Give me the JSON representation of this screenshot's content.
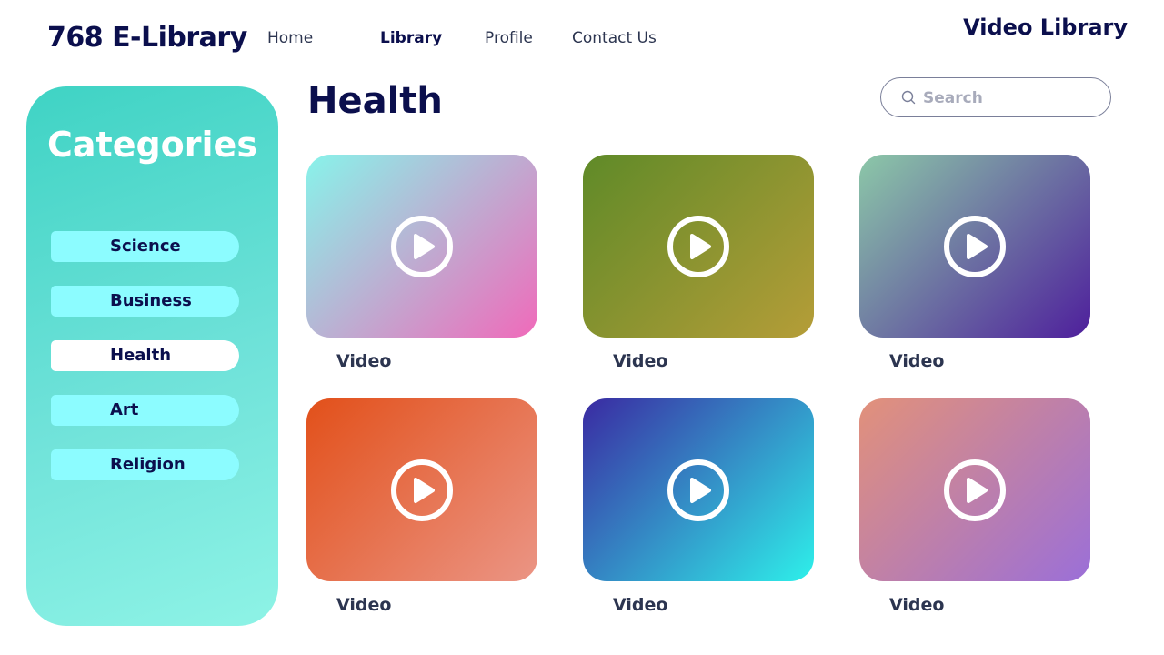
{
  "header": {
    "brand": "768 E-Library",
    "nav": [
      "Home",
      "Library",
      "Profile",
      "Contact Us"
    ],
    "active_nav": "Library",
    "page_label": "Video Library"
  },
  "sidebar": {
    "title": "Categories",
    "items": [
      "Science",
      "Business",
      "Health",
      "Art",
      "Religion"
    ],
    "active": "Health"
  },
  "main": {
    "heading": "Health",
    "search": {
      "placeholder": "Search",
      "value": ""
    },
    "videos": [
      {
        "label": "Video",
        "gradient": [
          "#88f3ea",
          "#f06aba"
        ]
      },
      {
        "label": "Video",
        "gradient": [
          "#5f8a28",
          "#b59d38"
        ]
      },
      {
        "label": "Video",
        "gradient": [
          "#8cc8a8",
          "#4e1f9c"
        ]
      },
      {
        "label": "Video",
        "gradient": [
          "#e2501a",
          "#eb9585"
        ]
      },
      {
        "label": "Video",
        "gradient": [
          "#3a2aa2",
          "#2ef0ea"
        ]
      },
      {
        "label": "Video",
        "gradient": [
          "#e2917a",
          "#9b6fd8"
        ]
      }
    ]
  },
  "colors": {
    "text_dark": "#0b0f4d",
    "sidebar_pill": "#8cfcff",
    "sidebar_pill_active": "#ffffff"
  },
  "icons": {
    "search": "search-icon",
    "play": "play-icon"
  }
}
